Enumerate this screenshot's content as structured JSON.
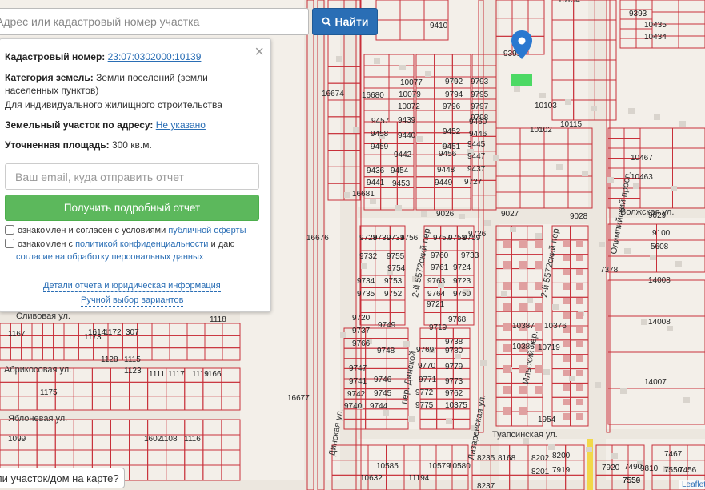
{
  "search": {
    "placeholder": "Адрес или кадастровый номер участка",
    "button_label": "Найти"
  },
  "info": {
    "cad_label": "Кадастровый номер:",
    "cad_value": "23:07:0302000:10139",
    "category_label": "Категория земель:",
    "category_value": "Земли поселений (земли населенных пунктов)",
    "usage": "Для индивидуального жилищного строительства",
    "address_label": "Земельный участок по адресу:",
    "address_value": "Не указано",
    "area_label": "Уточненная площадь:",
    "area_value": "300 кв.м."
  },
  "form": {
    "email_placeholder": "Ваш email, куда отправить отчет",
    "report_button": "Получить подробный отчет",
    "offer_prefix": "ознакомлен и согласен с условиями ",
    "offer_link": "публичной оферты",
    "privacy_prefix": "ознакомлен с ",
    "privacy_link": "политикой конфиденциальности",
    "privacy_mid": " и даю",
    "consent_link": "согласие на обработку персональных данных",
    "details_link": "Детали отчета и юридическая информация",
    "manual_link": "Ручной выбор вариантов"
  },
  "bottom_bubble": "ли участок/дом на карте?",
  "attribution": "Leaflet",
  "map": {
    "streets": {
      "volzhskaya": "Волжская ул.",
      "olimpiyskiy": "Олимпийский просп.",
      "tuapsinskaya": "Туапсинская ул.",
      "dinskaya": "Динская ул.",
      "dinskoy_per": "пер. Динской",
      "lazarevskaya": "Лазаревская ул.",
      "ilskiy": "Ильский пер.",
      "per5572": "2-й 5572ский пер",
      "per5572b": "2-й 5572ский пер",
      "livovaya": "Сливовая ул.",
      "abrikosovaya": "Абрикосовая ул.",
      "yablonevaya": "Яблоневая ул."
    },
    "labels": [
      "9410",
      "10154",
      "9393",
      "10435",
      "10434",
      "9391",
      "10103",
      "10102",
      "10115",
      "10467",
      "10463",
      "9029",
      "9100",
      "5608",
      "14008",
      "14008",
      "14007",
      "7378",
      "9026",
      "9027",
      "9028",
      "16674",
      "16680",
      "16681",
      "16676",
      "16677",
      "10077",
      "10079",
      "10072",
      "9792",
      "9793",
      "9794",
      "9795",
      "9796",
      "9797",
      "9798",
      "9457",
      "9439",
      "9458",
      "9440",
      "9459",
      "9452",
      "9460",
      "9451",
      "9446",
      "9445",
      "9442",
      "9456",
      "9447",
      "9436",
      "9454",
      "9448",
      "9437",
      "9441",
      "9453",
      "9449",
      "9727",
      "9728",
      "9730",
      "9731",
      "9756",
      "9757",
      "9758",
      "9759",
      "9726",
      "9732",
      "9755",
      "9760",
      "9733",
      "9754",
      "9761",
      "9724",
      "9734",
      "9753",
      "9763",
      "9723",
      "9735",
      "9752",
      "9764",
      "9750",
      "9721",
      "9720",
      "9737",
      "9749",
      "9719",
      "9766",
      "9768",
      "9738",
      "9748",
      "9769",
      "9780",
      "9747",
      "9770",
      "9779",
      "9741",
      "9746",
      "9771",
      "9773",
      "9742",
      "9745",
      "9772",
      "9762",
      "9740",
      "9744",
      "9775",
      "10375",
      "10387",
      "10376",
      "10386",
      "10719",
      "1954",
      "1175",
      "1614",
      "1173",
      "1172",
      "307",
      "1118",
      "1128",
      "1115",
      "1123",
      "1111",
      "1117",
      "1119",
      "1166",
      "1167",
      "1099",
      "1602",
      "1116",
      "1108",
      "10632",
      "10585",
      "11194",
      "10579",
      "10580",
      "8235",
      "8168",
      "8202",
      "8237",
      "8201",
      "8200",
      "7919",
      "7920",
      "7490",
      "9810",
      "7556",
      "7539",
      "7467",
      "7550",
      "7456"
    ],
    "selected_parcel_color": "#4cd964",
    "boundary_color": "#c8303a",
    "marker_color": "#2a78d0"
  },
  "colors": {
    "accent": "#2a6eb5",
    "success": "#5cb85c"
  }
}
